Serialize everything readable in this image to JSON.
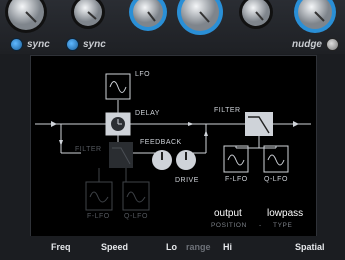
{
  "controls": {
    "sync_left_label": "sync",
    "sync_right_label": "sync",
    "nudge_label": "nudge"
  },
  "diagram": {
    "lfo_label": "LFO",
    "delay_label": "DELAY",
    "filter_label_right": "FILTER",
    "filter_label_left": "FILTER",
    "feedback_label": "FEEDBACK",
    "drive_label": "DRIVE",
    "f_lfo_left": "F-LFO",
    "q_lfo_left": "Q-LFO",
    "f_lfo_right": "F-LFO",
    "q_lfo_right": "Q-LFO"
  },
  "output": {
    "position_value": "output",
    "type_value": "lowpass",
    "position_label": "POSITION",
    "separator": "-",
    "type_label": "TYPE"
  },
  "bottom_labels": {
    "freq": "Freq",
    "speed": "Speed",
    "lo": "Lo",
    "range": "range",
    "hi": "Hi",
    "spatial": "Spatial"
  },
  "colors": {
    "accent": "#2a8fd6",
    "knob_silver": "#d9dde2"
  }
}
